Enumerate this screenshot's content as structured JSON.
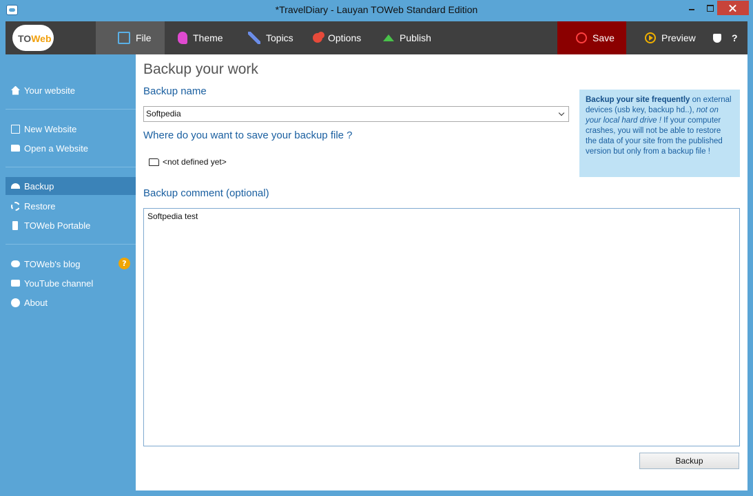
{
  "window": {
    "title": "*TravelDiary - Lauyan TOWeb Standard Edition"
  },
  "logo": {
    "text_to": "TO",
    "text_web": "Web"
  },
  "toolbar": {
    "file": "File",
    "theme": "Theme",
    "topics": "Topics",
    "options": "Options",
    "publish": "Publish",
    "save": "Save",
    "preview": "Preview",
    "help": "?"
  },
  "sidebar": {
    "your_website": "Your website",
    "new_website": "New Website",
    "open_website": "Open a Website",
    "backup": "Backup",
    "restore": "Restore",
    "portable": "TOWeb Portable",
    "blog": "TOWeb's blog",
    "blog_badge": "?",
    "youtube": "YouTube channel",
    "about": "About"
  },
  "main": {
    "title": "Backup your work",
    "backup_name_label": "Backup name",
    "backup_name_value": "Softpedia",
    "save_location_label": "Where do you want to save your backup file ?",
    "save_location_value": "<not defined yet>",
    "comment_label": "Backup comment (optional)",
    "comment_value": "Softpedia test",
    "backup_button": "Backup"
  },
  "tip": {
    "bold": "Backup your site frequently",
    "part1": " on external devices (usb key, backup hd..), ",
    "italic": "not on your local hard drive !",
    "part2": " If your computer crashes, you will not be able to restore the data of your site from the published version but only from a backup file !"
  }
}
